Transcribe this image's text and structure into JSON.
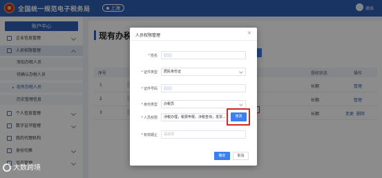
{
  "header": {
    "app_title": "全国统一规范电子税务局",
    "city": "上海",
    "user": "退出"
  },
  "sidebar": {
    "title": "账户中心",
    "items": [
      {
        "label": "企业信息管理",
        "icon": "building-icon"
      },
      {
        "label": "人员权限管理",
        "icon": "user-icon",
        "open": true
      },
      {
        "label": "个人信息管理",
        "icon": "person-icon"
      },
      {
        "label": "数字证书管理",
        "icon": "certificate-icon"
      },
      {
        "label": "我的代理机构",
        "icon": "agency-icon"
      },
      {
        "label": "身份切换",
        "icon": "switch-icon"
      },
      {
        "label": "日志管理",
        "icon": "log-icon"
      }
    ],
    "subitems": [
      {
        "label": "添加办税人员"
      },
      {
        "label": "待确认办税人员"
      },
      {
        "label": "现有办税人员",
        "active": true
      },
      {
        "label": "历史管理信息"
      }
    ]
  },
  "main": {
    "title": "现有办税",
    "table": {
      "headers": [
        "序号",
        "授权状态",
        "操作"
      ],
      "rows": [
        {
          "index": "1",
          "status": "长期",
          "action": "管理"
        },
        {
          "index": "2",
          "status": "长期",
          "action": "管理"
        },
        {
          "index": "3",
          "status": "长期",
          "action": "变更",
          "action2": "删除"
        }
      ]
    }
  },
  "modal": {
    "title": "人员权限管理",
    "close": "×",
    "fields": {
      "name": {
        "label": "姓名",
        "required": true
      },
      "id_type": {
        "label": "证件类型",
        "required": true,
        "value": "居民身份证"
      },
      "id_number": {
        "label": "证件号码",
        "required": true,
        "value": ""
      },
      "identity": {
        "label": "身份类型",
        "required": true,
        "value": "办税员"
      },
      "permission": {
        "label": "人员权限",
        "required": true,
        "value": "涉税办理，税费申报，涉税查询，发票..."
      },
      "deadline": {
        "label": "有效期止",
        "required": true,
        "placeholder": "请选择"
      }
    },
    "edit_button": "修改",
    "confirm_button": "确定",
    "cancel_button": "取消"
  },
  "watermark": {
    "text": "大数跨境"
  },
  "colors": {
    "primary": "#2f5fb4",
    "button": "#3c7ff0",
    "highlight": "#d7261e"
  }
}
